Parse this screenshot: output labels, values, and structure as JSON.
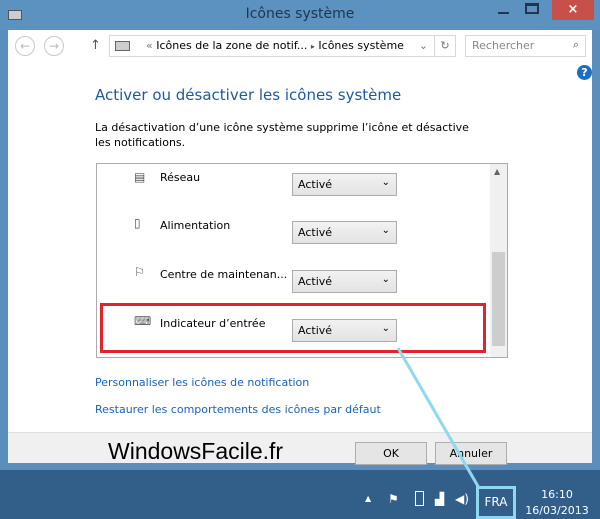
{
  "window": {
    "title": "Icônes système",
    "close": "×"
  },
  "nav": {
    "back": "←",
    "forward": "→",
    "up": "↑",
    "breadcrumb_prefix": "«",
    "breadcrumb_parent": "Icônes de la zone de notif...",
    "breadcrumb_sep": "▸",
    "breadcrumb_current": "Icônes système",
    "dropdown": "⌄",
    "refresh": "↻",
    "search_placeholder": "Rechercher",
    "search_icon": "⌕"
  },
  "help": "?",
  "main": {
    "heading": "Activer ou désactiver les icônes système",
    "description": "La désactivation d’une icône système supprime l’icône et désactive les notifications.",
    "rows": [
      {
        "label": "Réseau",
        "value": "Activé",
        "icon": "network-icon"
      },
      {
        "label": "Alimentation",
        "value": "Activé",
        "icon": "power-icon"
      },
      {
        "label": "Centre de maintenan...",
        "value": "Activé",
        "icon": "flag-icon"
      },
      {
        "label": "Indicateur d’entrée",
        "value": "Activé",
        "icon": "keyboard-icon"
      }
    ],
    "links": [
      "Personnaliser les icônes de notification",
      "Restaurer les comportements des icônes par défaut"
    ]
  },
  "buttons": {
    "ok": "OK",
    "cancel": "Annuler"
  },
  "watermark": "WindowsFacile.fr",
  "taskbar": {
    "language": "FRA",
    "time": "16:10",
    "date": "16/03/2013"
  },
  "colors": {
    "highlight": "#e0232e",
    "callout": "#8fd8ee",
    "link": "#1a62b8"
  }
}
